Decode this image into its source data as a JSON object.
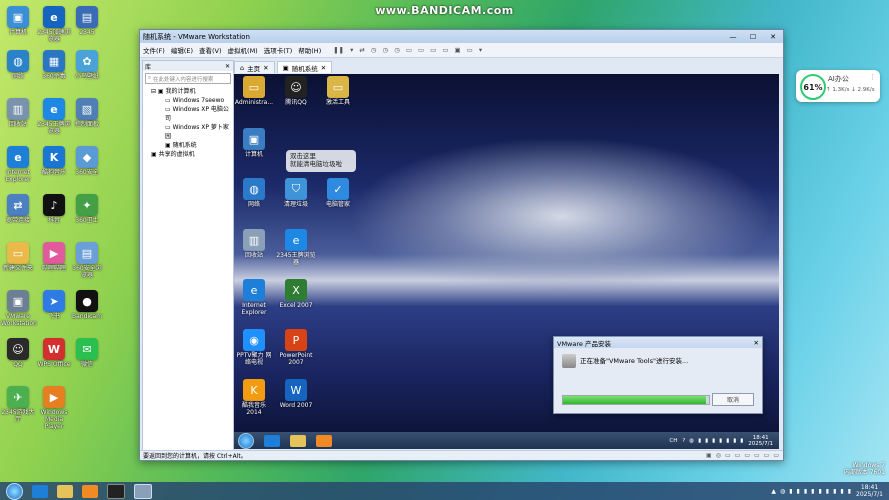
{
  "watermark": "www.BANDICAM.com",
  "desktop_icons": [
    {
      "label": "计算机",
      "color": "#3b8fd6",
      "glyph": "▣"
    },
    {
      "label": "2345加速浏览器",
      "color": "#1565c0",
      "glyph": "e"
    },
    {
      "label": "2345",
      "color": "#3a6bb5",
      "glyph": "▤"
    },
    {
      "label": "网络",
      "color": "#2a82c9",
      "glyph": "◍"
    },
    {
      "label": "360杀毒",
      "color": "#2b76c2",
      "glyph": "▦"
    },
    {
      "label": "小鸟壁纸",
      "color": "#4aa3d8",
      "glyph": "✿"
    },
    {
      "label": "回收站",
      "color": "#7a93ad",
      "glyph": "▥"
    },
    {
      "label": "2345王牌浏览器",
      "color": "#1e88e5",
      "glyph": "e"
    },
    {
      "label": "控制面板",
      "color": "#4f7fb5",
      "glyph": "▧"
    },
    {
      "label": "Internet Explorer",
      "color": "#1e7fd8",
      "glyph": "e"
    },
    {
      "label": "酷狗音乐",
      "color": "#1976d2",
      "glyph": "K"
    },
    {
      "label": "360安全",
      "color": "#5b9bd5",
      "glyph": "◆"
    },
    {
      "label": "宽带连接",
      "color": "#4b80c3",
      "glyph": "⇄"
    },
    {
      "label": "抖音",
      "color": "#111111",
      "glyph": "♪"
    },
    {
      "label": "360卫士",
      "color": "#43a047",
      "glyph": "✦"
    },
    {
      "label": "新建文件夹",
      "color": "#e9b949",
      "glyph": "▭"
    },
    {
      "label": "哔哩哔哩",
      "color": "#e05a9c",
      "glyph": "▶"
    },
    {
      "label": "360安全浏览器",
      "color": "#6a9fd8",
      "glyph": "▤"
    },
    {
      "label": "VMware Workstation",
      "color": "#6d7f95",
      "glyph": "▣"
    },
    {
      "label": "飞书",
      "color": "#2e7be6",
      "glyph": "➤"
    },
    {
      "label": "Bandicam",
      "color": "#111111",
      "glyph": "●"
    },
    {
      "label": "QQ",
      "color": "#2a2a2a",
      "glyph": "☺"
    },
    {
      "label": "WPS Office",
      "color": "#d32f2f",
      "glyph": "W"
    },
    {
      "label": "微信",
      "color": "#2bbf4f",
      "glyph": "✉"
    },
    {
      "label": "2345游戏大厅",
      "color": "#4caf50",
      "glyph": "✈"
    },
    {
      "label": "Windows Media Player",
      "color": "#e67e22",
      "glyph": "▶"
    }
  ],
  "widget": {
    "percent": "61%",
    "title": "AI办公",
    "up": "↑ 1.3K/s",
    "down": "↓ 2.9K/s",
    "menu": "⋮"
  },
  "vmware": {
    "title": "随机系统 - VMware Workstation",
    "win_min": "—",
    "win_max": "☐",
    "win_close": "✕",
    "menus": [
      "文件(F)",
      "编辑(E)",
      "查看(V)",
      "虚拟机(M)",
      "选项卡(T)",
      "帮助(H)"
    ],
    "toolbar_icons": [
      "❚❚",
      "▾",
      "⇄",
      "◷",
      "◷",
      "◷",
      "▭",
      "▭",
      "▭",
      "▭",
      "▣",
      "▭",
      "▾"
    ],
    "library": {
      "header": "库",
      "close": "✕",
      "search_placeholder": "在此处键入内容进行搜索",
      "tree": [
        "我的计算机",
        "Windows 7seewo",
        "Windows XP 电脑公司",
        "Windows XP 萝卜家园",
        "随机系统",
        "共享的虚拟机"
      ]
    },
    "tabs": [
      {
        "label": "主页",
        "close": "✕"
      },
      {
        "label": "随机系统",
        "close": "✕"
      }
    ],
    "status": "要返回到您的计算机，请按 Ctrl+Alt。",
    "status_icons": [
      "▣",
      "◎",
      "▭",
      "▭",
      "▭",
      "▭",
      "▭",
      "▭"
    ]
  },
  "guest": {
    "icons": [
      {
        "label": "Administra...",
        "color": "#d9a931",
        "glyph": "▭"
      },
      {
        "label": "腾讯QQ",
        "color": "#222222",
        "glyph": "☺"
      },
      {
        "label": "激活工具",
        "color": "#d9b646",
        "glyph": "▭"
      },
      {
        "label": "计算机",
        "color": "#3a7dc2",
        "glyph": "▣"
      },
      {
        "label": "网络",
        "color": "#2a7ac9",
        "glyph": "◍"
      },
      {
        "label": "清理垃圾",
        "color": "#3f93d9",
        "glyph": "⛉"
      },
      {
        "label": "电脑管家",
        "color": "#2f8be0",
        "glyph": "✓"
      },
      {
        "label": "回收站",
        "color": "#8aa0b8",
        "glyph": "▥"
      },
      {
        "label": "2345王牌浏览器",
        "color": "#1e88e5",
        "glyph": "e"
      },
      {
        "label": "Internet Explorer",
        "color": "#1e7fd8",
        "glyph": "e"
      },
      {
        "label": "Excel 2007",
        "color": "#2e7d32",
        "glyph": "X"
      },
      {
        "label": "PPTV聚力 网络电视",
        "color": "#1e90ff",
        "glyph": "◉"
      },
      {
        "label": "PowerPoint 2007",
        "color": "#d84315",
        "glyph": "P"
      },
      {
        "label": "酷我音乐 2014",
        "color": "#f39c12",
        "glyph": "K"
      },
      {
        "label": "Word 2007",
        "color": "#1565c0",
        "glyph": "W"
      }
    ],
    "tooltip_line1": "双击这里",
    "tooltip_line2": "就能清电脑垃圾啦",
    "taskbar": {
      "time": "18:41",
      "date": "2025/7/1",
      "lang": "CH",
      "tray_icons": [
        "?",
        "◍",
        "▮",
        "▮",
        "▮",
        "▮",
        "▮",
        "▮",
        "▮"
      ]
    },
    "dialog": {
      "title": "VMware 产品安装",
      "close": "✕",
      "message": "正在准备\"VMware Tools\"进行安装...",
      "progress": 0.98,
      "cancel": "取消"
    }
  },
  "host_info": {
    "line1": "Windows 7",
    "line2": "内部版本 7601",
    "line3": "18:41",
    "line4": "2025/7/1"
  },
  "host_taskbar": {
    "time": "18:41",
    "date": "2025/7/1",
    "tray_icons": [
      "▲",
      "◍",
      "▮",
      "▮",
      "▮",
      "▮",
      "▮",
      "▮",
      "▮",
      "▮",
      "▮"
    ]
  }
}
